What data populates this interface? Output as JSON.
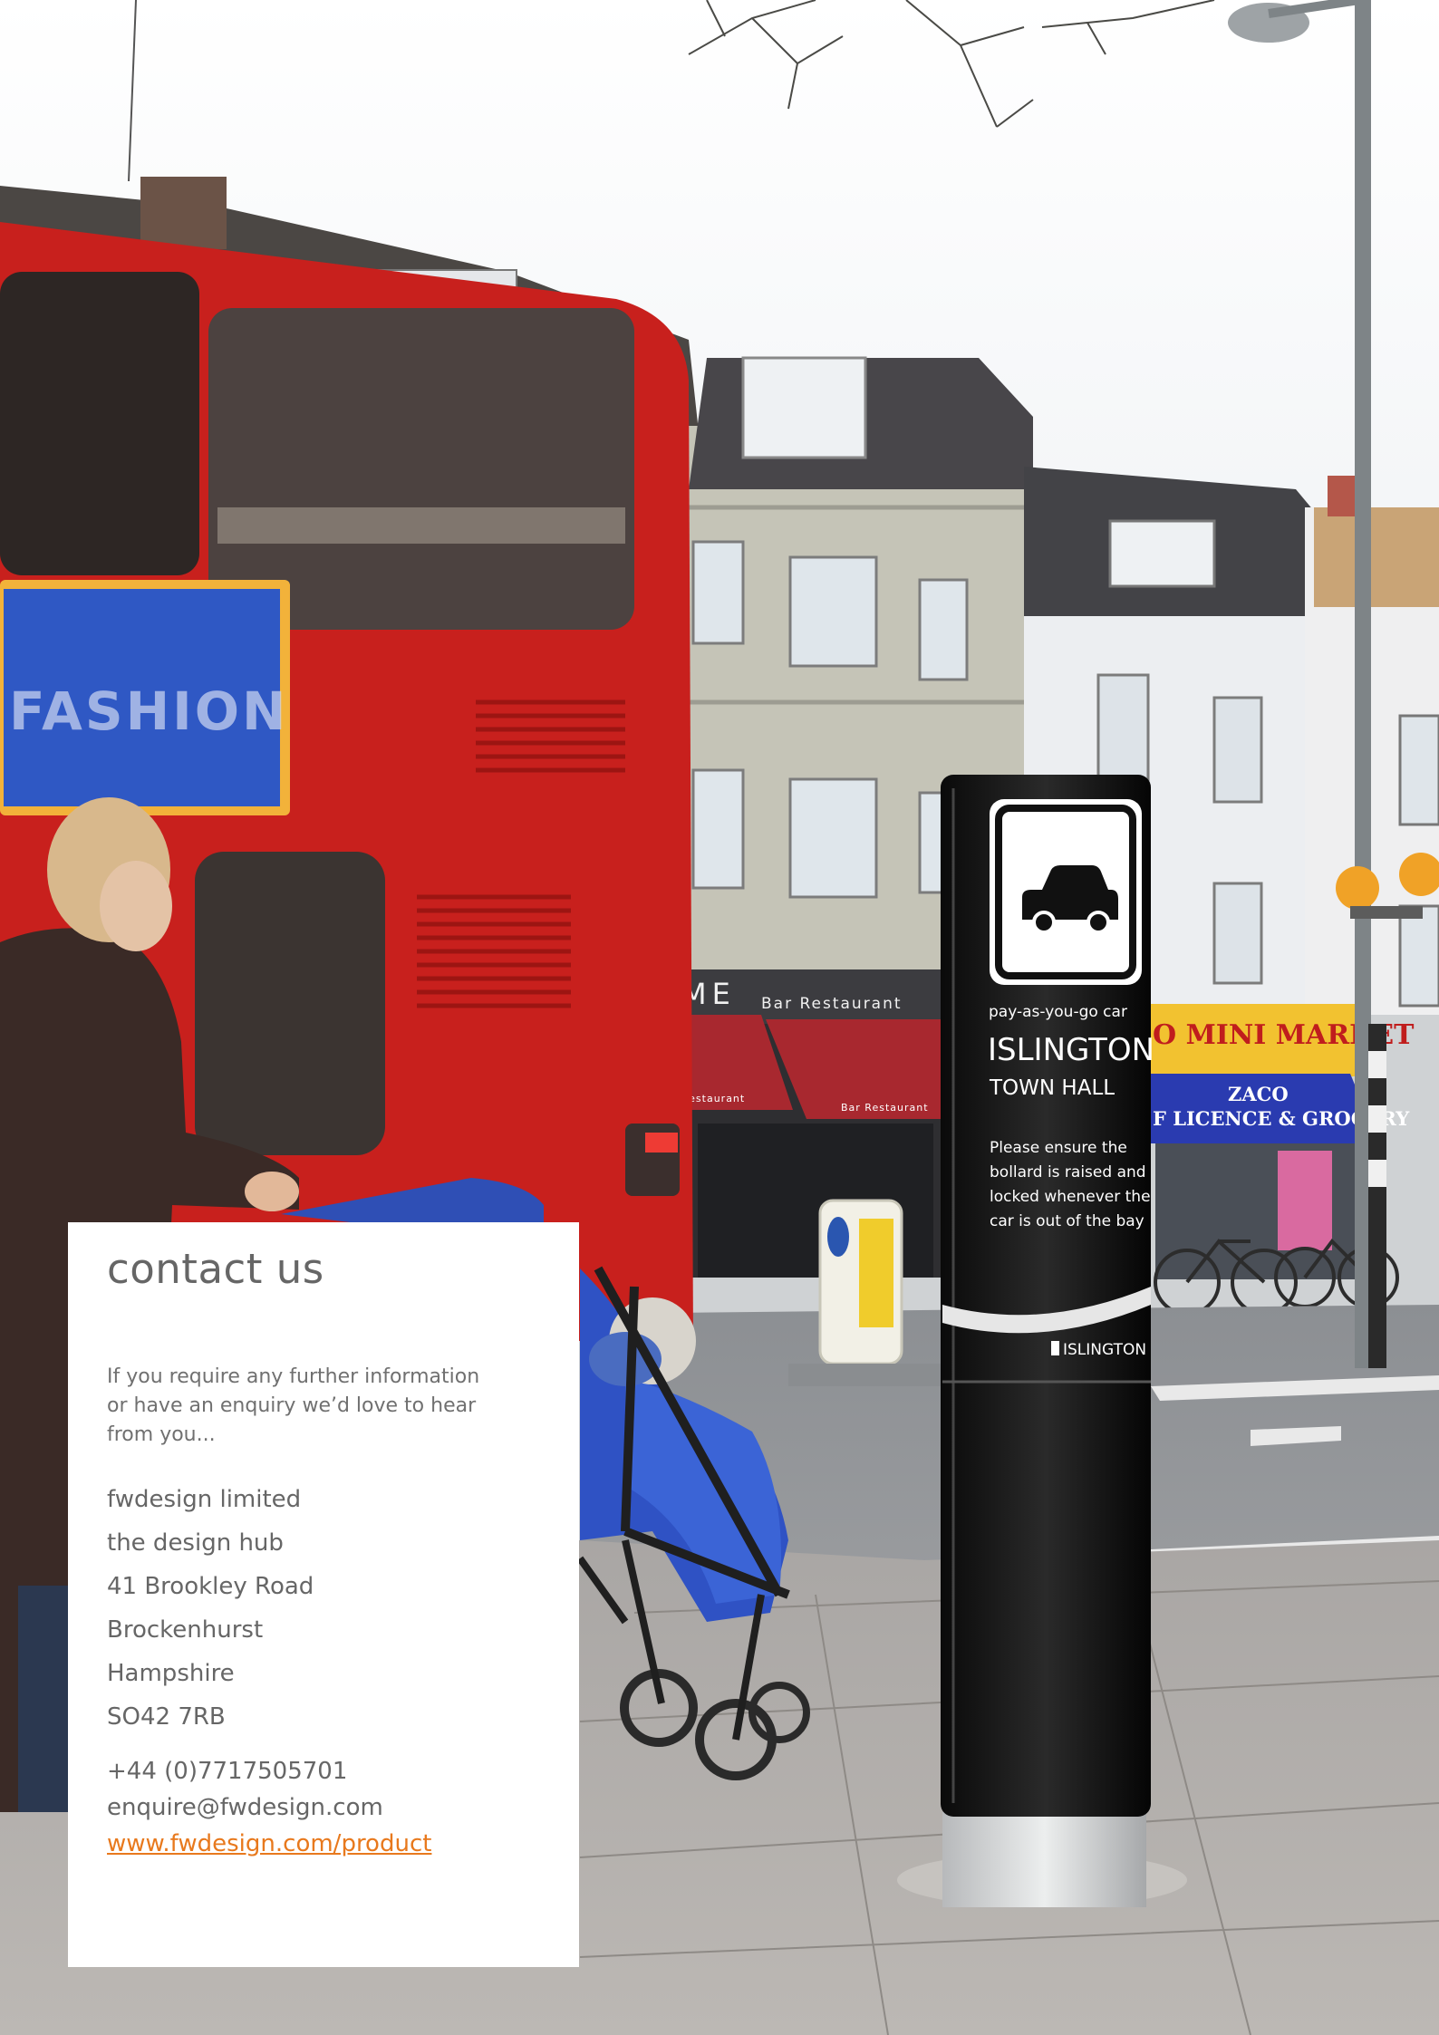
{
  "contact": {
    "title": "contact us",
    "intro": "If you require any further information or have an enquiry we’d love to hear from you...",
    "address": [
      "fwdesign limited",
      "the design hub",
      "41 Brookley Road",
      "Brockenhurst",
      "Hampshire",
      "SO42 7RB"
    ],
    "phone": "+44 (0)7717505701",
    "email": "enquire@fwdesign.com",
    "website": "www.fwdesign.com/product",
    "link_color": "#e8791d"
  },
  "photo": {
    "bollard_sign": {
      "subtitle": "pay-as-you-go car",
      "title": "ISLINGTON",
      "subtitle2": "TOWN HALL",
      "notice": [
        "Please ensure the",
        "bollard is raised and",
        "locked whenever the",
        "car is out of the bay"
      ],
      "brand": "ISLINGTON",
      "icon": "car-icon"
    },
    "shop_signs": {
      "restaurant": "ME",
      "restaurant_sub": "Bar   Restaurant",
      "awning_left": "Restaurant",
      "awning_right": "Bar   Restaurant",
      "market": "O MINI MARKET",
      "grocery_name": "ZACO",
      "grocery": "F LICENCE & GROCERY",
      "bus_advert": "FASHION"
    },
    "colors": {
      "bus": "#c8201d",
      "grocery_awning": "#2a3bb0",
      "market_sign": "#f2c230",
      "awning": "#a8282f"
    }
  }
}
